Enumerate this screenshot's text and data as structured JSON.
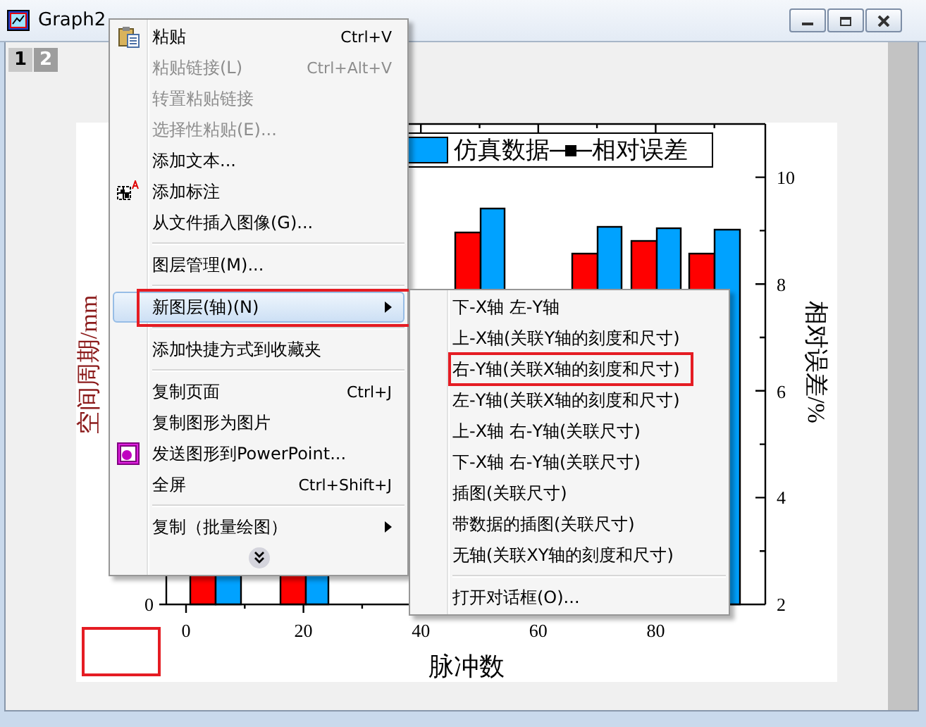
{
  "window": {
    "title": "Graph2"
  },
  "page_tabs": [
    {
      "label": "1",
      "selected": true
    },
    {
      "label": "2",
      "selected": false
    }
  ],
  "graph": {
    "legend": {
      "labels": [
        "仿真数据",
        "相对误差"
      ]
    },
    "x_axis": {
      "title": "脉冲数",
      "tick_labels": [
        "0",
        "20",
        "40",
        "60",
        "80"
      ]
    },
    "left_axis": {
      "title": "空间周期/mm",
      "tick_labels": [
        "0"
      ]
    },
    "right_axis": {
      "title": "相对误差/%",
      "tick_labels": [
        "10",
        "8",
        "6",
        "4",
        "2"
      ]
    }
  },
  "context_menu": {
    "groups": [
      [
        {
          "kind": "paste",
          "label": "粘贴",
          "shortcut": "Ctrl+V",
          "submenu": false,
          "disabled": false,
          "selected": false,
          "marked": false
        },
        {
          "kind": "plain",
          "label": "粘贴链接(L)",
          "shortcut": "Ctrl+Alt+V",
          "submenu": false,
          "disabled": true,
          "selected": false,
          "marked": false
        },
        {
          "kind": "plain",
          "label": "转置粘贴链接",
          "submenu": false,
          "disabled": true,
          "selected": false,
          "marked": false
        },
        {
          "kind": "plain",
          "label": "选择性粘贴(E)...",
          "submenu": false,
          "disabled": true,
          "selected": false,
          "marked": false
        },
        {
          "kind": "plain",
          "label": "添加文本...",
          "submenu": false,
          "disabled": false,
          "selected": false,
          "marked": false
        },
        {
          "kind": "callout",
          "label": "添加标注",
          "submenu": false,
          "disabled": false,
          "selected": false,
          "marked": false
        },
        {
          "kind": "plain",
          "label": "从文件插入图像(G)...",
          "submenu": false,
          "disabled": false,
          "selected": false,
          "marked": false
        }
      ],
      [
        {
          "kind": "plain",
          "label": "图层管理(M)...",
          "submenu": false,
          "disabled": false,
          "selected": false,
          "marked": false
        }
      ],
      [
        {
          "kind": "plain",
          "label": "新图层(轴)(N)",
          "submenu": true,
          "disabled": false,
          "selected": true,
          "marked": true
        }
      ],
      [
        {
          "kind": "plain",
          "label": "添加快捷方式到收藏夹",
          "submenu": false,
          "disabled": false,
          "selected": false,
          "marked": false
        }
      ],
      [
        {
          "kind": "plain",
          "label": "复制页面",
          "shortcut": "Ctrl+J",
          "submenu": false,
          "disabled": false,
          "selected": false,
          "marked": false
        },
        {
          "kind": "plain",
          "label": "复制图形为图片",
          "submenu": false,
          "disabled": false,
          "selected": false,
          "marked": false
        },
        {
          "kind": "ppt",
          "label": "发送图形到PowerPoint...",
          "submenu": false,
          "disabled": false,
          "selected": false,
          "marked": false
        },
        {
          "kind": "plain",
          "label": "全屏",
          "shortcut": "Ctrl+Shift+J",
          "submenu": false,
          "disabled": false,
          "selected": false,
          "marked": false
        }
      ],
      [
        {
          "kind": "plain",
          "label": "复制（批量绘图）",
          "submenu": true,
          "disabled": false,
          "selected": false,
          "marked": false
        }
      ]
    ],
    "more_indicator": true
  },
  "submenu": {
    "groups": [
      [
        {
          "label": "下-X轴 左-Y轴",
          "submenu": false,
          "disabled": false,
          "selected": false,
          "marked": false
        },
        {
          "label": "上-X轴(关联Y轴的刻度和尺寸)",
          "submenu": false,
          "disabled": false,
          "selected": false,
          "marked": false
        },
        {
          "label": "右-Y轴(关联X轴的刻度和尺寸)",
          "submenu": false,
          "disabled": false,
          "selected": false,
          "marked": true
        },
        {
          "label": "左-Y轴(关联X轴的刻度和尺寸)",
          "submenu": false,
          "disabled": false,
          "selected": false,
          "marked": false
        },
        {
          "label": "上-X轴 右-Y轴(关联尺寸)",
          "submenu": false,
          "disabled": false,
          "selected": false,
          "marked": false
        },
        {
          "label": "下-X轴 右-Y轴(关联尺寸)",
          "submenu": false,
          "disabled": false,
          "selected": false,
          "marked": false
        },
        {
          "label": "插图(关联尺寸)",
          "submenu": false,
          "disabled": false,
          "selected": false,
          "marked": false
        },
        {
          "label": "带数据的插图(关联尺寸)",
          "submenu": false,
          "disabled": false,
          "selected": false,
          "marked": false
        },
        {
          "label": "无轴(关联XY轴的刻度和尺寸)",
          "submenu": false,
          "disabled": false,
          "selected": false,
          "marked": false
        }
      ],
      [
        {
          "label": "打开对话框(O)...",
          "submenu": false,
          "disabled": false,
          "selected": false,
          "marked": false
        }
      ]
    ]
  }
}
